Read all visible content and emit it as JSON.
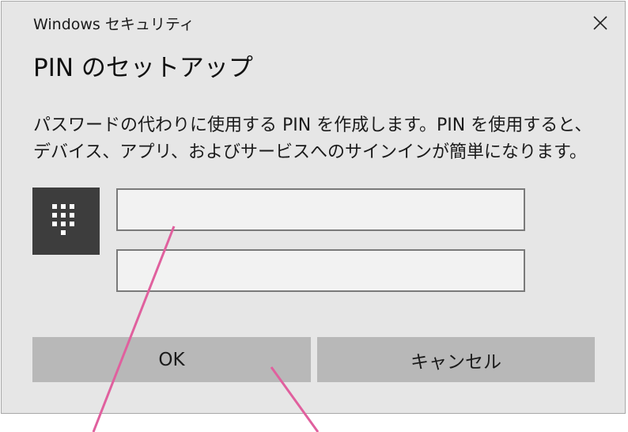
{
  "window": {
    "title": "Windows セキュリティ",
    "close_icon": "close-icon"
  },
  "dialog": {
    "heading": "PIN のセットアップ",
    "description_line1": "パスワードの代わりに使用する PIN を作成します。PIN を使用すると、",
    "description_line2": "デバイス、アプリ、およびサービスへのサインインが簡単になります。"
  },
  "pin_icon": "keypad-icon",
  "fields": {
    "new_pin_value": "",
    "confirm_pin_value": ""
  },
  "buttons": {
    "ok_label": "OK",
    "cancel_label": "キャンセル"
  },
  "colors": {
    "dialog_background": "#e6e6e6",
    "button_background": "#b8b8b8",
    "icon_tile": "#3d3d3d",
    "callout_line": "#e0609e"
  }
}
